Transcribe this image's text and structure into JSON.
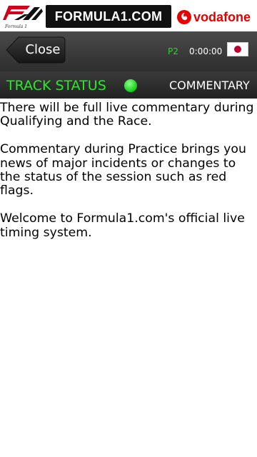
{
  "banner": {
    "f1_logo_text": "Formula 1",
    "site_name": "FORMULA1.COM",
    "sponsor": "vodafone"
  },
  "toolbar": {
    "close_label": "Close",
    "session": "P2",
    "clock": "0:00:00",
    "flag_icon": "japan-flag-icon"
  },
  "statusbar": {
    "track_status_label": "TRACK STATUS",
    "status_color": "#22dd22",
    "commentary_label": "COMMENTARY"
  },
  "content": {
    "paragraphs": [
      "There will be full live commentary during Qualifying and the Race.",
      "Commentary during Practice brings you news of major incidents or changes to the status of the session such as red flags.",
      "Welcome to Formula1.com's official live timing system."
    ]
  },
  "colors": {
    "accent_green": "#22ee22",
    "vodafone_red": "#e60000",
    "toolbar_dark": "#2e2e2e"
  }
}
